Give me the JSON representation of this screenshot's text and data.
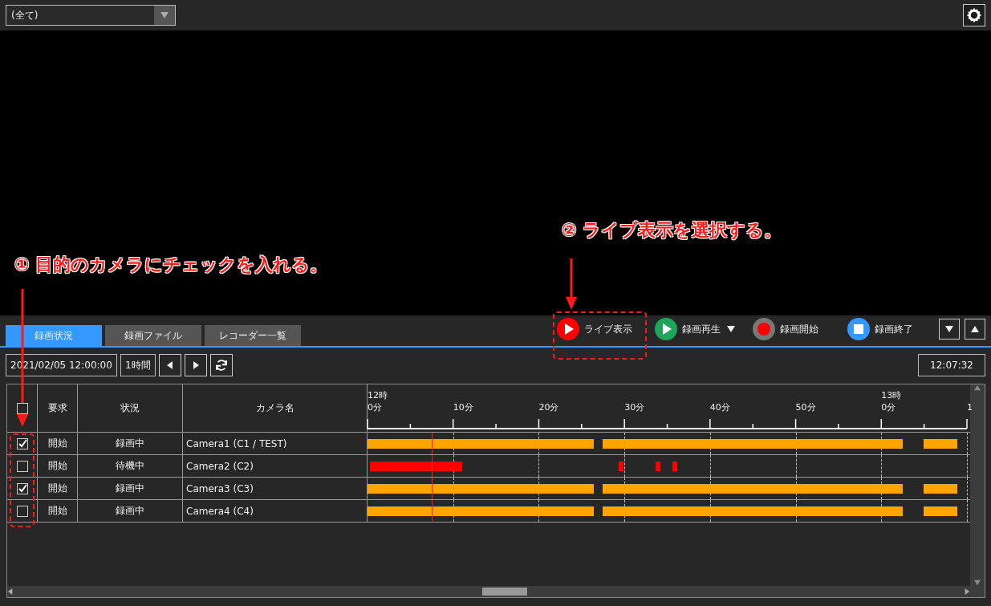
{
  "filter": {
    "value": "(全て)"
  },
  "tabs": [
    {
      "label": "録画状況",
      "selected": true
    },
    {
      "label": "録画ファイル",
      "selected": false
    },
    {
      "label": "レコーダー一覧",
      "selected": false
    }
  ],
  "actions": [
    {
      "kind": "live",
      "label": "ライブ表示"
    },
    {
      "kind": "play",
      "label": "録画再生"
    },
    {
      "kind": "record",
      "label": "録画開始"
    },
    {
      "kind": "stop",
      "label": "録画終了"
    }
  ],
  "toolbar": {
    "datetime": "2021/02/05 12:00:00",
    "span": "1時間",
    "clock": "12:07:32"
  },
  "table": {
    "header_checked": false,
    "columns": [
      "要求",
      "状況",
      "カメラ名"
    ],
    "ticks": [
      {
        "hour": "12時",
        "minute": "0分"
      },
      {
        "minute": "10分"
      },
      {
        "minute": "20分"
      },
      {
        "minute": "30分"
      },
      {
        "minute": "40分"
      },
      {
        "minute": "50分"
      },
      {
        "hour": "13時",
        "minute": "0分"
      },
      {
        "minute": "1"
      }
    ],
    "rows": [
      {
        "checked": true,
        "request": "開始",
        "status": "録画中",
        "camera": "Camera1 (C1 / TEST)",
        "color": "#ffa500"
      },
      {
        "checked": false,
        "request": "開始",
        "status": "待機中",
        "camera": "Camera2 (C2)",
        "color": "#ff0000"
      },
      {
        "checked": true,
        "request": "開始",
        "status": "録画中",
        "camera": "Camera3 (C3)",
        "color": "#ffa500"
      },
      {
        "checked": false,
        "request": "開始",
        "status": "録画中",
        "camera": "Camera4 (C4)",
        "color": "#ffa500"
      }
    ]
  },
  "annotations": [
    {
      "text": "① 目的のカメラにチェックを入れる。"
    },
    {
      "text": "② ライブ表示を選択する。"
    }
  ]
}
